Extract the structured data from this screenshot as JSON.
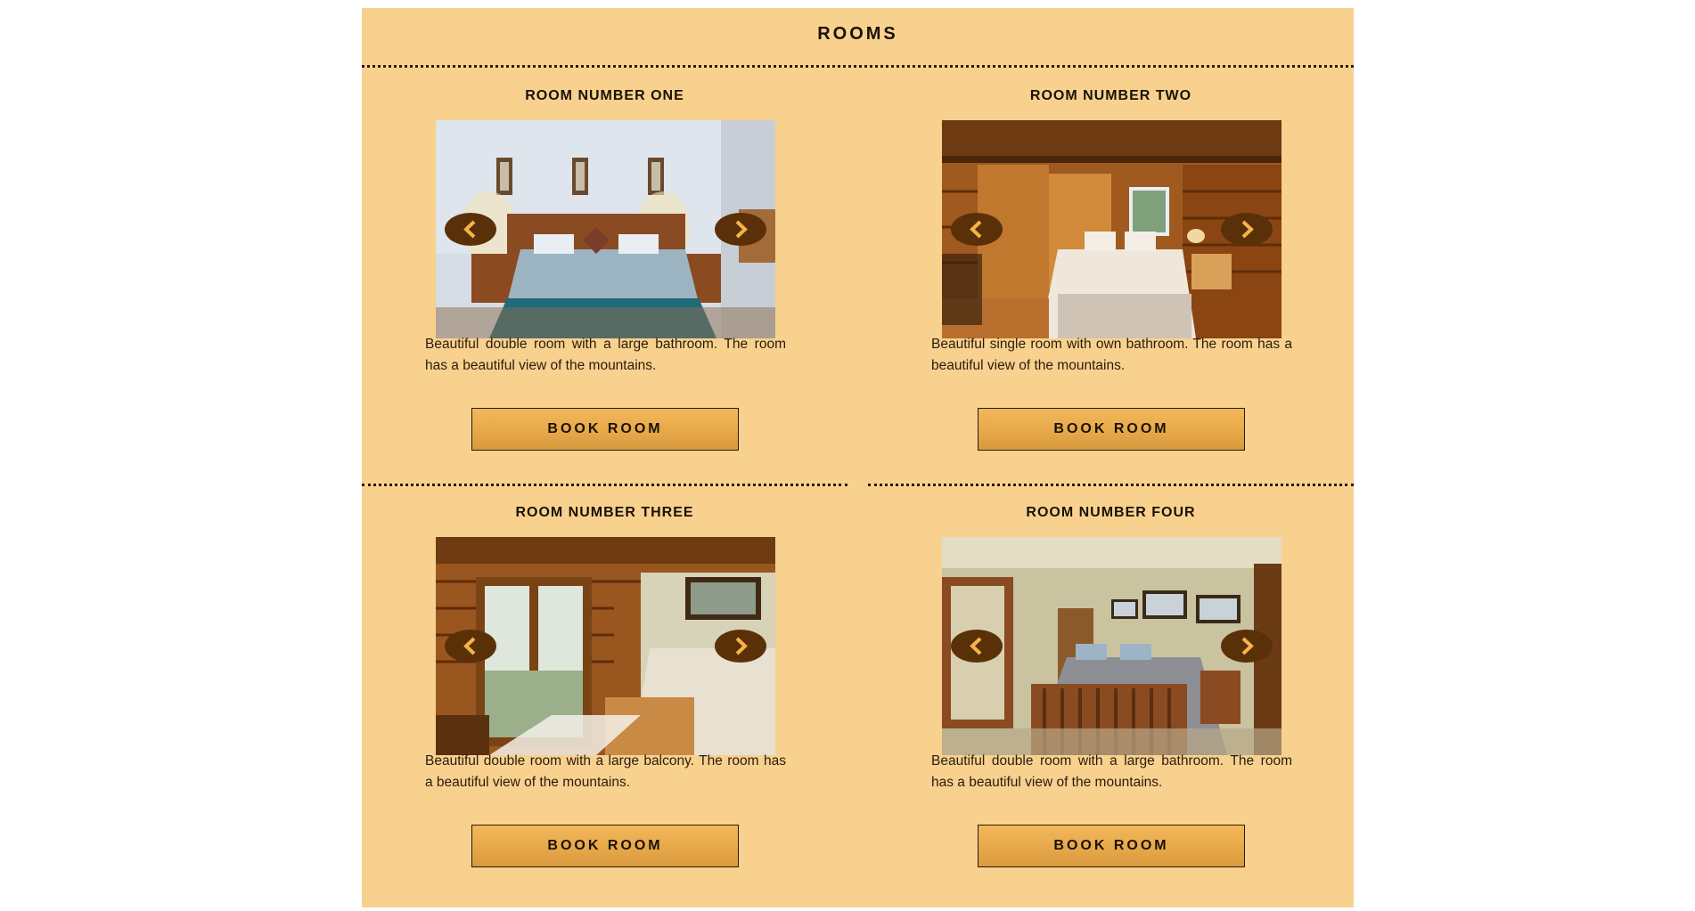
{
  "section": {
    "title": "ROOMS"
  },
  "colors": {
    "panel_background": "#f9d18f",
    "button_gradient_top": "#f2b85a",
    "button_gradient_bottom": "#d99a3e",
    "arrow_background": "#5a3009",
    "arrow_chevron": "#f5b34a"
  },
  "rooms": [
    {
      "title": "ROOM NUMBER ONE",
      "image_subject": "bedroom with double bed and blue bedspread",
      "description": "Beautiful double room with a large bathroom. The room has a beautiful view of the mountains.",
      "button_label": "BOOK ROOM",
      "prev_icon": "chevron-left-icon",
      "next_icon": "chevron-right-icon"
    },
    {
      "title": "ROOM NUMBER TWO",
      "image_subject": "log cabin bedroom with single bed",
      "description": "Beautiful single room with own bathroom. The room has a beautiful view of the mountains.",
      "button_label": "BOOK ROOM",
      "prev_icon": "chevron-left-icon",
      "next_icon": "chevron-right-icon"
    },
    {
      "title": "ROOM NUMBER THREE",
      "image_subject": "log cabin bedroom with balcony door",
      "description": "Beautiful double room with a large balcony. The room has a beautiful view of the mountains.",
      "button_label": "BOOK ROOM",
      "prev_icon": "chevron-left-icon",
      "next_icon": "chevron-right-icon"
    },
    {
      "title": "ROOM NUMBER FOUR",
      "image_subject": "bedroom with wooden bed frame and framed pictures",
      "description": "Beautiful double room with a large bathroom. The room has a beautiful view of the mountains.",
      "button_label": "BOOK ROOM",
      "prev_icon": "chevron-left-icon",
      "next_icon": "chevron-right-icon"
    }
  ]
}
